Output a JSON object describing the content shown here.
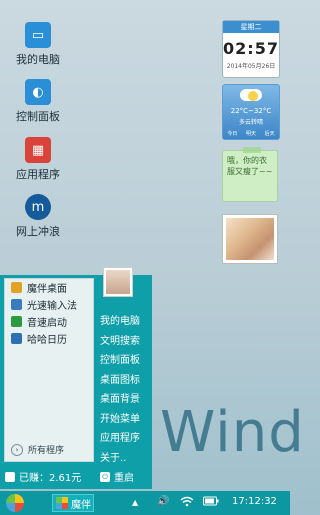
{
  "desktop_icons": [
    {
      "label": "我的电脑",
      "icon": "computer-icon",
      "color": "#2a8fd6"
    },
    {
      "label": "控制面板",
      "icon": "control-panel-icon",
      "color": "#2a8fd6"
    },
    {
      "label": "应用程序",
      "icon": "apps-icon",
      "color": "#d9433a"
    },
    {
      "label": "网上冲浪",
      "icon": "browser-icon",
      "color": "#155a9a"
    }
  ],
  "calendar_widget": {
    "weekday": "星期二",
    "time": "02:57",
    "date": "2014年05月26日"
  },
  "weather_widget": {
    "temp": "22°C~32°C",
    "sky": "多云转晴",
    "today": "今日",
    "tomorrow": "明天",
    "day_after": "后天"
  },
  "note_widget": {
    "text": "哦，你的衣服又瘦了~~"
  },
  "start_menu": {
    "left_items": [
      {
        "label": "魔伴桌面",
        "icon": "moban-icon",
        "color": "#e2a224"
      },
      {
        "label": "光速输入法",
        "icon": "keyboard-icon",
        "color": "#3a7bbf"
      },
      {
        "label": "音速启动",
        "icon": "v-launch-icon",
        "color": "#2e9a3f"
      },
      {
        "label": "哈哈日历",
        "icon": "calendar-icon",
        "color": "#2f6fb3"
      }
    ],
    "all_programs": "所有程序",
    "right_items": [
      "我的电脑",
      "文明搜索",
      "控制面板",
      "桌面图标",
      "桌面背景",
      "开始菜单",
      "应用程序",
      "关于.."
    ],
    "earnings": "已赚：2.61元",
    "restart": "重启"
  },
  "wallpaper_text": "Wind",
  "taskbar": {
    "active_app": "魔伴",
    "tray_up": "▲",
    "volume": "🔊",
    "wifi": "wifi",
    "battery": "battery",
    "clock": "17:12:32"
  },
  "colors": {
    "accent": "#0e9fa8",
    "taskbar": "#0d98a1"
  }
}
